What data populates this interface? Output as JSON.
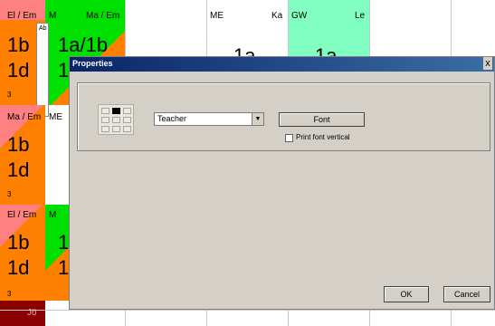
{
  "timetable": {
    "headers": {
      "c1": "El / Em",
      "c2a": "M",
      "c2b": "Ma / Em",
      "c4a": "ME",
      "c4b": "Ka",
      "c5a": "GW",
      "c5b": "Le"
    },
    "ab_label": "Ab",
    "r1_col1a": "1b",
    "r1_col1b": "1d",
    "r1_col2a": "1a/1b",
    "r1_col2b": "1",
    "r1_num": "3",
    "r1_partial1": "1a",
    "r1_partial2": "1a",
    "r2_col1_head": "Ma / Em",
    "r2_col2_head": "ME",
    "r2_col1a": "1b",
    "r2_col1b": "1d",
    "r2_num": "3",
    "r3_col1_head": "El / Em",
    "r3_col2_head": "M",
    "r3_col1a": "1b",
    "r3_col1b": "1d",
    "r3_col2a": "1",
    "r3_col2b": "1",
    "r3_num": "3",
    "r4_partial": "Jö"
  },
  "dialog": {
    "title": "Properties",
    "close": "x",
    "select_value": "Teacher",
    "font_button": "Font",
    "checkbox_label": "Print font vertical",
    "ok": "OK",
    "cancel": "Cancel"
  },
  "colors": {
    "orange": "#ff7f00",
    "green": "#00e000",
    "pink": "#ff8080",
    "mint": "#80ffc0",
    "darkred": "#8b0000"
  }
}
